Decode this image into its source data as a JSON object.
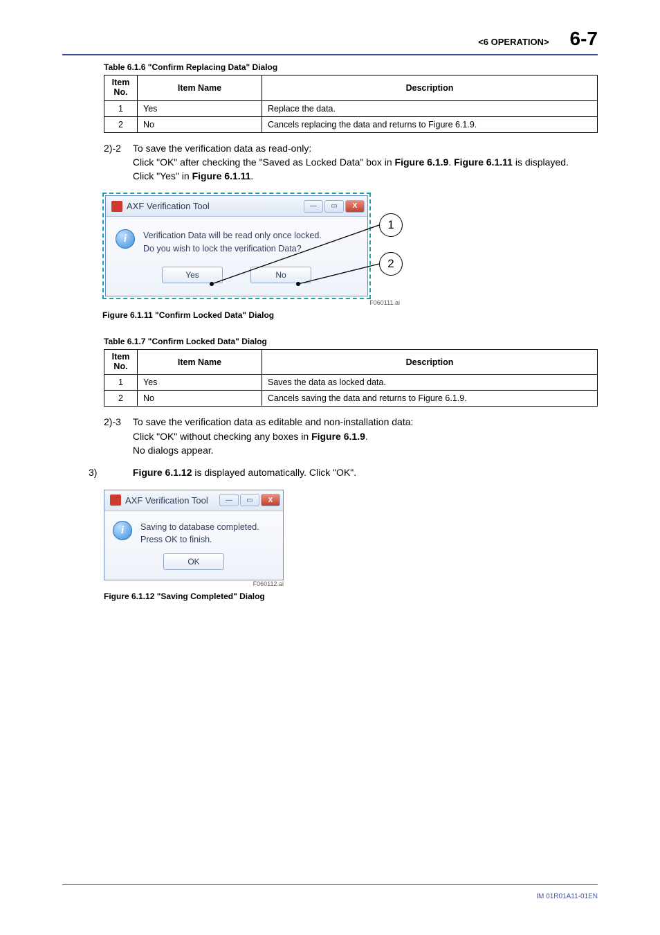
{
  "header": {
    "section": "<6  OPERATION>",
    "page": "6-7"
  },
  "table1": {
    "caption": "Table 6.1.6 \"Confirm Replacing Data\" Dialog",
    "head": {
      "no": "Item No.",
      "name": "Item Name",
      "desc": "Description"
    },
    "rows": [
      {
        "no": "1",
        "name": "Yes",
        "desc": "Replace the data."
      },
      {
        "no": "2",
        "name": "No",
        "desc": "Cancels replacing the data and returns to Figure 6.1.9."
      }
    ]
  },
  "step22": {
    "label": "2)-2",
    "line1": "To save the verification data as read-only:",
    "line2a": "Click \"OK\" after checking the \"Saved as Locked Data\" box in ",
    "ref1": "Figure 6.1.9",
    "line2b": ". ",
    "ref2": "Figure 6.1.11",
    "line2c": " is displayed.",
    "line3a": "Click \"Yes\" in ",
    "ref3": "Figure 6.1.11",
    "line3b": "."
  },
  "dialog1": {
    "title": "AXF Verification Tool",
    "text1": "Verification Data will be read only once locked.",
    "text2": "Do you wish to lock the verification Data?",
    "yes": "Yes",
    "no": "No",
    "callout1": "1",
    "callout2": "2",
    "figref": "F060111.ai",
    "caption": "Figure 6.1.11 \"Confirm Locked Data\" Dialog"
  },
  "table2": {
    "caption": "Table 6.1.7 \"Confirm Locked Data\" Dialog",
    "head": {
      "no": "Item No.",
      "name": "Item Name",
      "desc": "Description"
    },
    "rows": [
      {
        "no": "1",
        "name": "Yes",
        "desc": "Saves the data as locked data."
      },
      {
        "no": "2",
        "name": "No",
        "desc": "Cancels saving the data and returns to Figure 6.1.9."
      }
    ]
  },
  "step23": {
    "label": "2)-3",
    "line1": "To save the verification data as editable and non-installation data:",
    "line2a": "Click \"OK\" without checking any boxes in ",
    "ref1": "Figure 6.1.9",
    "line2b": ".",
    "line3": "No dialogs appear."
  },
  "step3": {
    "label": "3)",
    "text_a": "",
    "ref": "Figure 6.1.12",
    "text_b": " is displayed automatically. Click \"OK\"."
  },
  "dialog2": {
    "title": "AXF Verification Tool",
    "text1": "Saving to database completed.",
    "text2": "Press OK to finish.",
    "ok": "OK",
    "figref": "F060112.ai",
    "caption": "Figure 6.1.12 \"Saving Completed\" Dialog"
  },
  "footer": {
    "code": "IM 01R01A11-01EN"
  }
}
